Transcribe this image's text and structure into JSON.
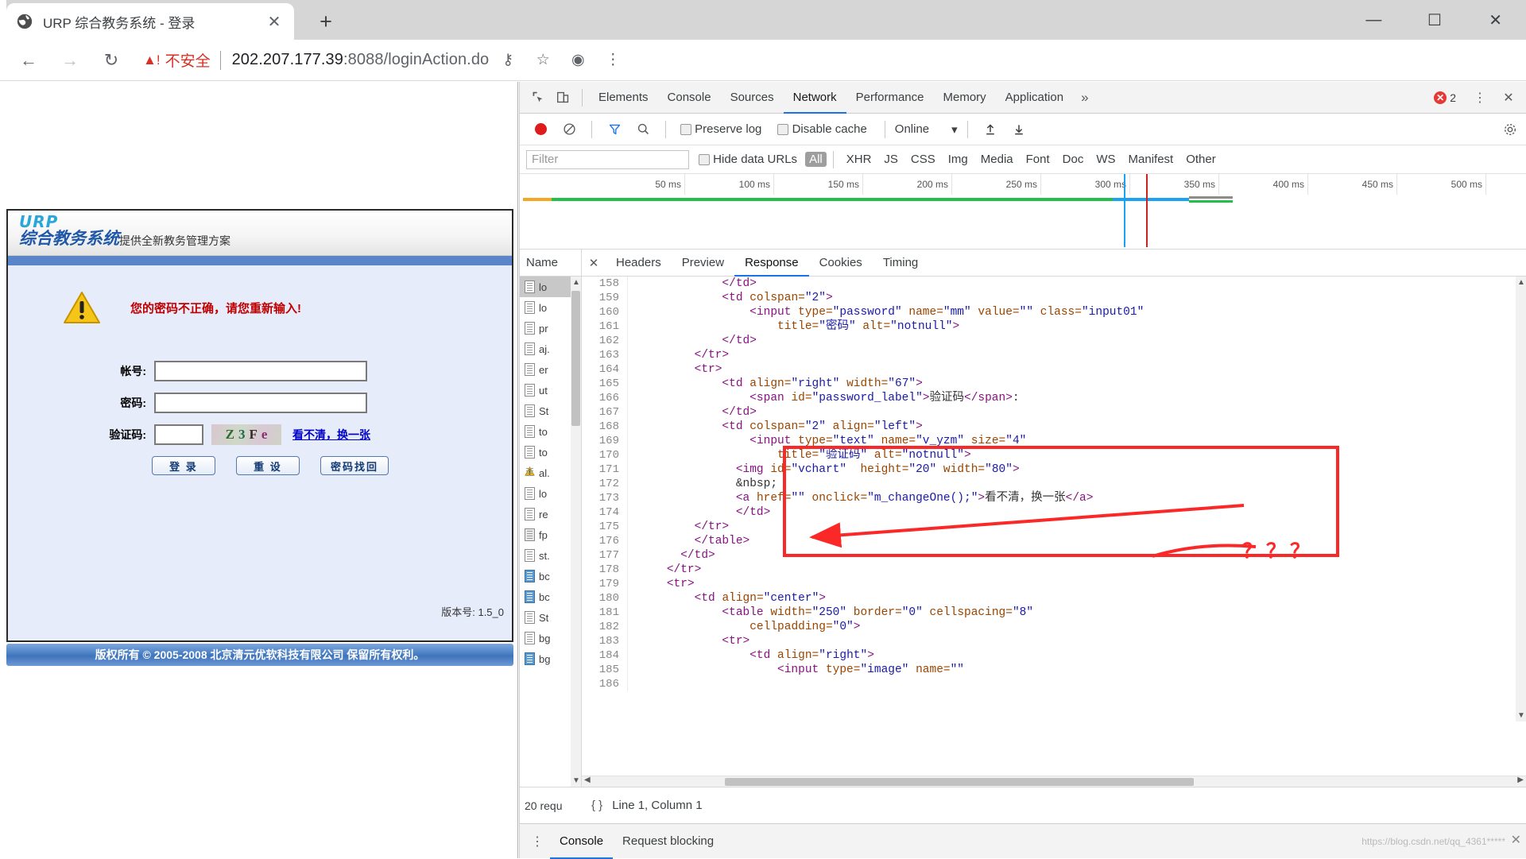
{
  "browser": {
    "tab": {
      "title": "URP 综合教务系统 - 登录",
      "favicon_icon": "globe-icon",
      "close_icon": "close-icon"
    },
    "new_tab_icon": "plus-icon",
    "window_controls": [
      {
        "name": "minimize",
        "glyph": "—"
      },
      {
        "name": "maximize",
        "glyph": "☐"
      },
      {
        "name": "close",
        "glyph": "✕"
      }
    ],
    "toolbar": {
      "back_icon": "back-arrow-icon",
      "forward_icon": "forward-arrow-icon",
      "reload_icon": "reload-icon",
      "security_warning_icon": "warning-triangle-icon",
      "security_label": "不安全",
      "url_host": "202.207.177.39",
      "url_rest": ":8088/loginAction.do",
      "key_icon": "key-icon",
      "star_icon": "star-icon",
      "profile_icon": "profile-avatar-icon",
      "menu_icon": "three-dot-menu-icon"
    }
  },
  "page": {
    "logo_line1": "URP",
    "logo_line2": "综合教务系统",
    "slogan": "提供全新教务管理方案",
    "warning_icon": "warning-triangle-icon",
    "warning_message": "您的密码不正确，请您重新输入!",
    "fields": [
      {
        "label": "帐号:",
        "value": "",
        "placeholder": "",
        "name": "account-input"
      },
      {
        "label": "密码:",
        "value": "",
        "placeholder": "",
        "name": "password-input"
      },
      {
        "label": "验证码:",
        "value": "",
        "placeholder": "",
        "name": "captcha-input"
      }
    ],
    "captcha_text": [
      "Z",
      "3",
      "F",
      "e"
    ],
    "refresh_captcha_link": "看不清，换一张",
    "buttons": [
      {
        "label": "登 录",
        "name": "login-button"
      },
      {
        "label": "重 设",
        "name": "reset-button"
      },
      {
        "label": "密码找回",
        "name": "password-recovery-button"
      }
    ],
    "version": "版本号: 1.5_0",
    "copyright": "版权所有 © 2005-2008 北京清元优软科技有限公司 保留所有权利。"
  },
  "devtools": {
    "inspect_icon": "inspect-cursor-icon",
    "device_toggle_icon": "device-toolbar-icon",
    "tabs": [
      {
        "label": "Elements",
        "active": false
      },
      {
        "label": "Console",
        "active": false
      },
      {
        "label": "Sources",
        "active": false
      },
      {
        "label": "Network",
        "active": true
      },
      {
        "label": "Performance",
        "active": false
      },
      {
        "label": "Memory",
        "active": false
      },
      {
        "label": "Application",
        "active": false
      }
    ],
    "overflow_icon": "chevron-double-right-icon",
    "error_count": "2",
    "error_badge_glyph": "✕",
    "settings_icon": "gear-icon",
    "panel_menu_icon": "three-dot-menu-icon",
    "close_icon": "close-icon",
    "network_toolbar": {
      "record_icon": "record-circle-icon",
      "clear_icon": "clear-no-entry-icon",
      "filter_icon": "funnel-filter-icon",
      "search_icon": "search-icon",
      "preserve_log_label": "Preserve log",
      "preserve_log_checked": false,
      "disable_cache_label": "Disable cache",
      "disable_cache_checked": false,
      "throttling_value": "Online",
      "throttling_caret": "▾",
      "import_icon": "upload-arrow-icon",
      "export_icon": "download-arrow-icon"
    },
    "filter_bar": {
      "filter_placeholder": "Filter",
      "filter_value": "",
      "hide_data_urls_label": "Hide data URLs",
      "hide_data_urls_checked": false,
      "types": [
        "All",
        "XHR",
        "JS",
        "CSS",
        "Img",
        "Media",
        "Font",
        "Doc",
        "WS",
        "Manifest",
        "Other"
      ],
      "selected_type": "All"
    },
    "timeline_ticks": [
      "50 ms",
      "100 ms",
      "150 ms",
      "200 ms",
      "250 ms",
      "300 ms",
      "350 ms",
      "400 ms",
      "450 ms",
      "500 ms"
    ],
    "name_column_header": "Name",
    "requests": [
      {
        "label": "lo",
        "icon": "document-icon",
        "selected": true
      },
      {
        "label": "lo",
        "icon": "document-icon",
        "selected": false
      },
      {
        "label": "pr",
        "icon": "document-icon",
        "selected": false
      },
      {
        "label": "aj.",
        "icon": "document-icon",
        "selected": false
      },
      {
        "label": "er",
        "icon": "document-icon",
        "selected": false
      },
      {
        "label": "ut",
        "icon": "document-icon",
        "selected": false
      },
      {
        "label": "St",
        "icon": "document-icon",
        "selected": false
      },
      {
        "label": "to",
        "icon": "document-icon",
        "selected": false
      },
      {
        "label": "to",
        "icon": "document-icon",
        "selected": false
      },
      {
        "label": "al.",
        "icon": "warning-icon",
        "selected": false
      },
      {
        "label": "lo",
        "icon": "document-icon",
        "selected": false
      },
      {
        "label": "re",
        "icon": "document-icon",
        "selected": false
      },
      {
        "label": "fp",
        "icon": "square-icon",
        "selected": false
      },
      {
        "label": "st.",
        "icon": "document-icon",
        "selected": false
      },
      {
        "label": "bc",
        "icon": "image-icon",
        "selected": false
      },
      {
        "label": "bc",
        "icon": "image-icon",
        "selected": false
      },
      {
        "label": "St",
        "icon": "document-icon",
        "selected": false
      },
      {
        "label": "bg",
        "icon": "document-icon",
        "selected": false
      },
      {
        "label": "bg",
        "icon": "image-icon",
        "selected": false
      }
    ],
    "detail_tabs": [
      {
        "label": "Headers",
        "active": false
      },
      {
        "label": "Preview",
        "active": false
      },
      {
        "label": "Response",
        "active": true
      },
      {
        "label": "Cookies",
        "active": false
      },
      {
        "label": "Timing",
        "active": false
      }
    ],
    "detail_close_icon": "close-icon",
    "code_lines": [
      {
        "n": "158",
        "indent": 6,
        "parts": [
          {
            "t": "tag",
            "s": "</td>"
          }
        ]
      },
      {
        "n": "159",
        "indent": 6,
        "parts": [
          {
            "t": "tag",
            "s": "<td "
          },
          {
            "t": "attr",
            "s": "colspan="
          },
          {
            "t": "val",
            "s": "\"2\""
          },
          {
            "t": "tag",
            "s": ">"
          }
        ]
      },
      {
        "n": "160",
        "indent": 8,
        "parts": [
          {
            "t": "tag",
            "s": "<input "
          },
          {
            "t": "attr",
            "s": "type="
          },
          {
            "t": "val",
            "s": "\"password\""
          },
          {
            "t": "attr",
            "s": " name="
          },
          {
            "t": "val",
            "s": "\"mm\""
          },
          {
            "t": "attr",
            "s": " value="
          },
          {
            "t": "val",
            "s": "\"\""
          },
          {
            "t": "attr",
            "s": " class="
          },
          {
            "t": "val",
            "s": "\"input01\""
          }
        ]
      },
      {
        "n": "161",
        "indent": 10,
        "parts": [
          {
            "t": "attr",
            "s": "title="
          },
          {
            "t": "val",
            "s": "\"密码\""
          },
          {
            "t": "attr",
            "s": " alt="
          },
          {
            "t": "val",
            "s": "\"notnull\""
          },
          {
            "t": "tag",
            "s": ">"
          }
        ]
      },
      {
        "n": "162",
        "indent": 6,
        "parts": [
          {
            "t": "tag",
            "s": "</td>"
          }
        ]
      },
      {
        "n": "163",
        "indent": 4,
        "parts": [
          {
            "t": "tag",
            "s": "</tr>"
          }
        ]
      },
      {
        "n": "164",
        "indent": 4,
        "parts": [
          {
            "t": "tag",
            "s": "<tr>"
          }
        ]
      },
      {
        "n": "165",
        "indent": 6,
        "parts": [
          {
            "t": "tag",
            "s": "<td "
          },
          {
            "t": "attr",
            "s": "align="
          },
          {
            "t": "val",
            "s": "\"right\""
          },
          {
            "t": "attr",
            "s": " width="
          },
          {
            "t": "val",
            "s": "\"67\""
          },
          {
            "t": "tag",
            "s": ">"
          }
        ]
      },
      {
        "n": "166",
        "indent": 8,
        "parts": [
          {
            "t": "tag",
            "s": "<span "
          },
          {
            "t": "attr",
            "s": "id="
          },
          {
            "t": "val",
            "s": "\"password_label\""
          },
          {
            "t": "tag",
            "s": ">"
          },
          {
            "t": "txt",
            "s": "验证码"
          },
          {
            "t": "tag",
            "s": "</span>"
          },
          {
            "t": "txt",
            "s": ":"
          }
        ]
      },
      {
        "n": "167",
        "indent": 6,
        "parts": [
          {
            "t": "tag",
            "s": "</td>"
          }
        ]
      },
      {
        "n": "168",
        "indent": 6,
        "parts": [
          {
            "t": "tag",
            "s": "<td "
          },
          {
            "t": "attr",
            "s": "colspan="
          },
          {
            "t": "val",
            "s": "\"2\""
          },
          {
            "t": "attr",
            "s": " align="
          },
          {
            "t": "val",
            "s": "\"left\""
          },
          {
            "t": "tag",
            "s": ">"
          }
        ]
      },
      {
        "n": "169",
        "indent": 8,
        "parts": [
          {
            "t": "tag",
            "s": "<input "
          },
          {
            "t": "attr",
            "s": "type="
          },
          {
            "t": "val",
            "s": "\"text\""
          },
          {
            "t": "attr",
            "s": " name="
          },
          {
            "t": "val",
            "s": "\"v_yzm\""
          },
          {
            "t": "attr",
            "s": " size="
          },
          {
            "t": "val",
            "s": "\"4\""
          }
        ]
      },
      {
        "n": "170",
        "indent": 10,
        "parts": [
          {
            "t": "attr",
            "s": "title="
          },
          {
            "t": "val",
            "s": "\"验证码\""
          },
          {
            "t": "attr",
            "s": " alt="
          },
          {
            "t": "val",
            "s": "\"notnull\""
          },
          {
            "t": "tag",
            "s": ">"
          }
        ]
      },
      {
        "n": "171",
        "indent": 7,
        "parts": [
          {
            "t": "tag",
            "s": "<img "
          },
          {
            "t": "attr",
            "s": "id="
          },
          {
            "t": "val",
            "s": "\"vchart\""
          },
          {
            "t": "attr",
            "s": "  height="
          },
          {
            "t": "val",
            "s": "\"20\""
          },
          {
            "t": "attr",
            "s": " width="
          },
          {
            "t": "val",
            "s": "\"80\""
          },
          {
            "t": "tag",
            "s": ">"
          }
        ]
      },
      {
        "n": "172",
        "indent": 7,
        "parts": [
          {
            "t": "txt",
            "s": "&nbsp;"
          }
        ]
      },
      {
        "n": "173",
        "indent": 7,
        "parts": [
          {
            "t": "tag",
            "s": "<a "
          },
          {
            "t": "attr",
            "s": "href="
          },
          {
            "t": "val",
            "s": "\"\""
          },
          {
            "t": "attr",
            "s": " onclick="
          },
          {
            "t": "val",
            "s": "\"m_changeOne();\""
          },
          {
            "t": "tag",
            "s": ">"
          },
          {
            "t": "txt",
            "s": "看不清，换一张"
          },
          {
            "t": "tag",
            "s": "</a>"
          }
        ]
      },
      {
        "n": "174",
        "indent": 7,
        "parts": [
          {
            "t": "tag",
            "s": "</td>"
          }
        ]
      },
      {
        "n": "175",
        "indent": 4,
        "parts": [
          {
            "t": "tag",
            "s": "</tr>"
          }
        ]
      },
      {
        "n": "176",
        "indent": 4,
        "parts": [
          {
            "t": "tag",
            "s": "</table>"
          }
        ]
      },
      {
        "n": "177",
        "indent": 3,
        "parts": [
          {
            "t": "tag",
            "s": "</td>"
          }
        ]
      },
      {
        "n": "178",
        "indent": 2,
        "parts": [
          {
            "t": "tag",
            "s": "</tr>"
          }
        ]
      },
      {
        "n": "179",
        "indent": 2,
        "parts": [
          {
            "t": "tag",
            "s": "<tr>"
          }
        ]
      },
      {
        "n": "180",
        "indent": 4,
        "parts": [
          {
            "t": "tag",
            "s": "<td "
          },
          {
            "t": "attr",
            "s": "align="
          },
          {
            "t": "val",
            "s": "\"center\""
          },
          {
            "t": "tag",
            "s": ">"
          }
        ]
      },
      {
        "n": "181",
        "indent": 6,
        "parts": [
          {
            "t": "tag",
            "s": "<table "
          },
          {
            "t": "attr",
            "s": "width="
          },
          {
            "t": "val",
            "s": "\"250\""
          },
          {
            "t": "attr",
            "s": " border="
          },
          {
            "t": "val",
            "s": "\"0\""
          },
          {
            "t": "attr",
            "s": " cellspacing="
          },
          {
            "t": "val",
            "s": "\"8\""
          }
        ]
      },
      {
        "n": "182",
        "indent": 8,
        "parts": [
          {
            "t": "attr",
            "s": "cellpadding="
          },
          {
            "t": "val",
            "s": "\"0\""
          },
          {
            "t": "tag",
            "s": ">"
          }
        ]
      },
      {
        "n": "183",
        "indent": 6,
        "parts": [
          {
            "t": "tag",
            "s": "<tr>"
          }
        ]
      },
      {
        "n": "184",
        "indent": 8,
        "parts": [
          {
            "t": "tag",
            "s": "<td "
          },
          {
            "t": "attr",
            "s": "align="
          },
          {
            "t": "val",
            "s": "\"right\""
          },
          {
            "t": "tag",
            "s": ">"
          }
        ]
      },
      {
        "n": "185",
        "indent": 10,
        "parts": [
          {
            "t": "tag",
            "s": "<input "
          },
          {
            "t": "attr",
            "s": "type="
          },
          {
            "t": "val",
            "s": "\"image\""
          },
          {
            "t": "attr",
            "s": " name="
          },
          {
            "t": "val",
            "s": "\"\""
          }
        ]
      },
      {
        "n": "186",
        "indent": 10,
        "parts": [
          {
            "t": "txt",
            "s": ""
          }
        ]
      }
    ],
    "status_bar": {
      "request_count": "20 requ",
      "format_icon": "pretty-print-braces-icon",
      "cursor_position": "Line 1, Column 1"
    },
    "drawer": {
      "menu_icon": "three-dot-menu-icon",
      "tabs": [
        {
          "label": "Console",
          "active": true
        },
        {
          "label": "Request blocking",
          "active": false
        }
      ],
      "close_icon": "close-icon"
    },
    "watermark": "https://blog.csdn.net/qq_4361*****"
  },
  "annotations": {
    "question_marks": "？？？",
    "arrow_color": "#fb2828",
    "highlight_color": "#fb2828"
  }
}
